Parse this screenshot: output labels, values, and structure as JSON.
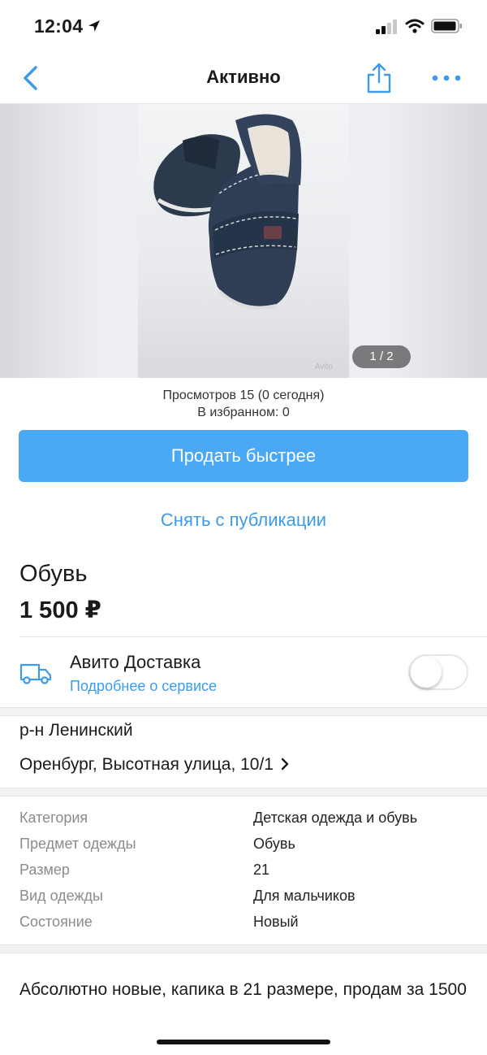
{
  "status_bar": {
    "time": "12:04",
    "icons": [
      "location-arrow-icon",
      "signal-icon",
      "wifi-icon",
      "battery-icon"
    ]
  },
  "nav": {
    "title": "Активно",
    "accent_color": "#3d9be9",
    "icons": [
      "back-chevron-icon",
      "share-icon",
      "more-dots-icon"
    ]
  },
  "gallery": {
    "counter": "1 / 2",
    "watermark": "Avito"
  },
  "stats": {
    "views": "Просмотров 15 (0 сегодня)",
    "favorites": "В избранном: 0"
  },
  "actions": {
    "sell_faster": "Продать быстрее",
    "sell_faster_color": "#4aa8f4",
    "unpublish": "Снять с публикации"
  },
  "item": {
    "title": "Обувь",
    "price": "1 500 ₽"
  },
  "delivery": {
    "title": "Авито Доставка",
    "link": "Подробнее о сервисе",
    "enabled": false
  },
  "location": {
    "district": "р-н Ленинский",
    "address": "Оренбург, Высотная улица, 10/1"
  },
  "params": [
    {
      "label": "Категория",
      "value": "Детская одежда и обувь"
    },
    {
      "label": "Предмет одежды",
      "value": "Обувь"
    },
    {
      "label": "Размер",
      "value": "21"
    },
    {
      "label": "Вид одежды",
      "value": "Для мальчиков"
    },
    {
      "label": "Состояние",
      "value": "Новый"
    }
  ],
  "description": "Абсолютно новые, капика в 21 размере, продам за 1500"
}
